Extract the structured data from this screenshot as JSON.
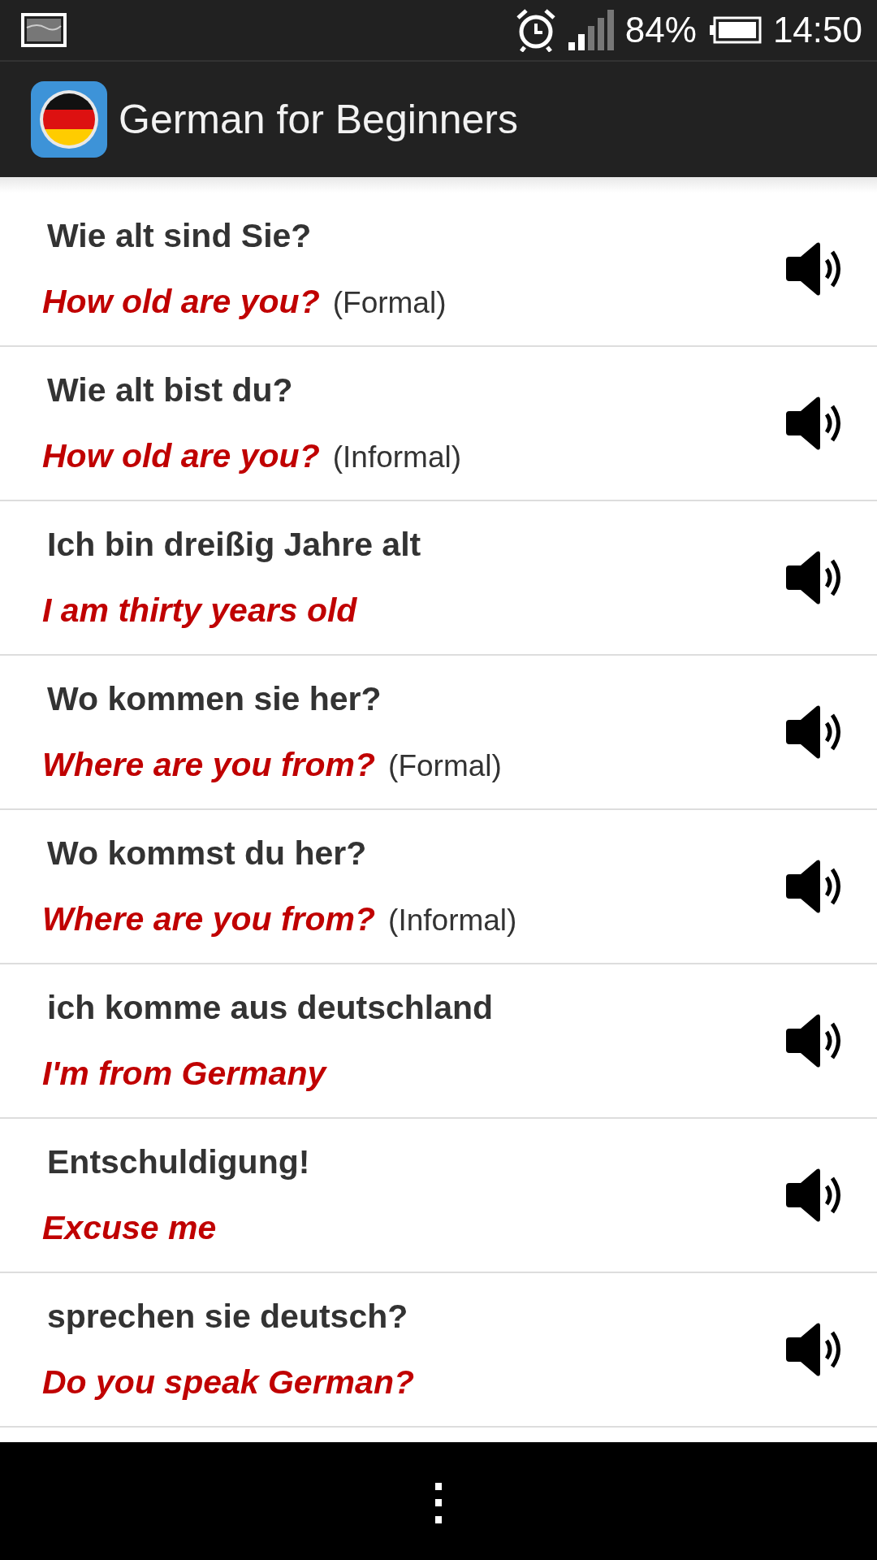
{
  "status_bar": {
    "battery": "84%",
    "time": "14:50"
  },
  "app_bar": {
    "title": "German for Beginners"
  },
  "phrases": [
    {
      "german": "Wie alt sind Sie?",
      "english": "How old are you?",
      "note": "(Formal)"
    },
    {
      "german": "Wie alt bist du?",
      "english": "How old are you?",
      "note": "(Informal)"
    },
    {
      "german": "Ich bin dreißig Jahre alt",
      "english": "I am thirty years old"
    },
    {
      "german": "Wo kommen sie her?",
      "english": "Where are you from?",
      "note": "(Formal)"
    },
    {
      "german": "Wo kommst du her?",
      "english": "Where are you from?",
      "note": "(Informal)"
    },
    {
      "german": "ich komme aus deutschland",
      "english": "I'm from Germany"
    },
    {
      "german": "Entschuldigung!",
      "english": "Excuse me"
    },
    {
      "german": "sprechen sie deutsch?",
      "english": "Do you speak German?"
    }
  ],
  "nav_bar": {
    "menu": "⋮"
  }
}
